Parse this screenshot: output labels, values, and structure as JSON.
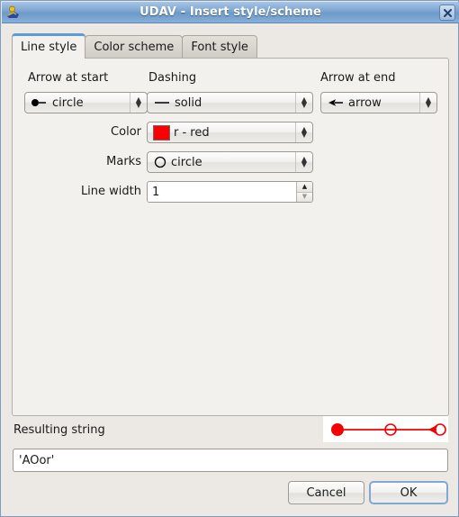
{
  "window": {
    "title": "UDAV - Insert style/scheme",
    "app_icon": "udav-app-icon",
    "close_label": "✖"
  },
  "tabs": [
    {
      "label": "Line style",
      "active": true
    },
    {
      "label": "Color scheme",
      "active": false
    },
    {
      "label": "Font style",
      "active": false
    }
  ],
  "line_style": {
    "headings": {
      "arrow_at_start": "Arrow at start",
      "dashing": "Dashing",
      "arrow_at_end": "Arrow at end"
    },
    "fields": {
      "arrow_start": {
        "value": "circle",
        "icon": "filled-circle-line-icon"
      },
      "dashing": {
        "value": "solid",
        "icon": "solid-line-icon"
      },
      "arrow_end": {
        "value": "arrow",
        "icon": "arrowhead-line-icon"
      },
      "color": {
        "label": "Color",
        "value": "r - red",
        "swatch": "#fb0000"
      },
      "marks": {
        "label": "Marks",
        "value": "circle",
        "icon": "open-circle-icon"
      },
      "line_width": {
        "label": "Line width",
        "value": "1"
      }
    },
    "spinner": {
      "up": "▲",
      "down": "▼"
    },
    "combo_arrows": {
      "up": "▲",
      "down": "▼"
    }
  },
  "result": {
    "label": "Resulting string",
    "value": "'AOor'",
    "preview": {
      "line_color": "#f40000",
      "start_marker": "filled-circle",
      "mid_marker": "open-circle",
      "end_marker": "arrow-open-circle"
    }
  },
  "buttons": {
    "cancel": "Cancel",
    "ok": "OK"
  }
}
